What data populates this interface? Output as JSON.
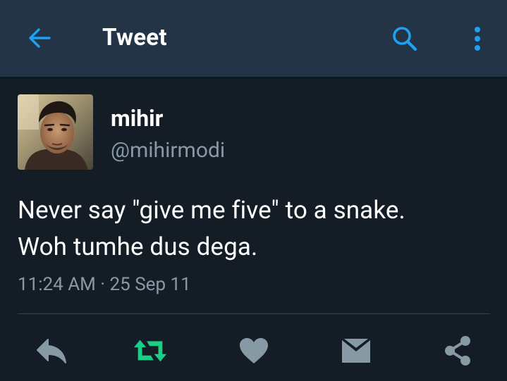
{
  "app_bar": {
    "title": "Tweet",
    "back_icon": "arrow-left-icon",
    "search_icon": "search-icon",
    "more_icon": "more-vertical-icon"
  },
  "tweet": {
    "author": {
      "name": "mihir",
      "handle": "@mihirmodi",
      "avatar": "profile-photo"
    },
    "text_lines": [
      "Never say \"give me five\" to a snake.",
      "Woh tumhe dus dega."
    ],
    "timestamp": "11:24 AM · 25 Sep 11",
    "actions": [
      {
        "name": "reply",
        "icon": "reply-icon"
      },
      {
        "name": "retweet",
        "icon": "retweet-icon"
      },
      {
        "name": "like",
        "icon": "heart-icon"
      },
      {
        "name": "direct-message",
        "icon": "envelope-icon"
      },
      {
        "name": "share",
        "icon": "share-icon"
      }
    ]
  },
  "colors": {
    "background": "#141d26",
    "app_bar": "#243447",
    "accent_blue": "#1da1f2",
    "retweet_green": "#19cf86",
    "secondary_text": "#8899a6",
    "icon_gray": "#8899a6",
    "divider": "#38444d"
  }
}
